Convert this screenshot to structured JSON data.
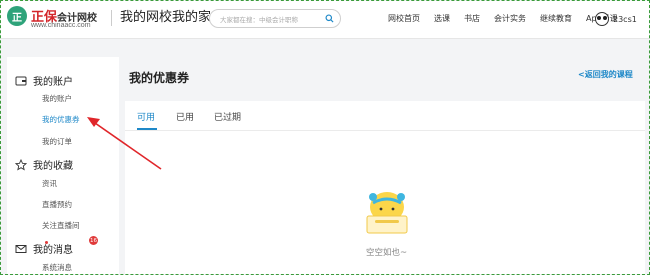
{
  "header": {
    "logo_mark": "正",
    "logo_brand_red": "正保",
    "logo_brand_rest": "会计网校",
    "logo_url": "www.chinaacc.com",
    "site_title": "我的网校我的家",
    "search": {
      "placeholder": "大家都在搜：中级会计职称"
    },
    "nav": [
      "网校首页",
      "选课",
      "书店",
      "会计实务",
      "继续教育",
      "App看课"
    ],
    "username": "23cs1"
  },
  "sidebar": {
    "account": {
      "title": "我的账户",
      "items": [
        "我的账户",
        "我的优惠券",
        "我的订单"
      ]
    },
    "favorites": {
      "title": "我的收藏",
      "items": [
        "资讯",
        "直播预约",
        "关注直播间"
      ]
    },
    "messages": {
      "title": "我的消息",
      "badge": "16",
      "items": [
        "系统消息"
      ]
    }
  },
  "main": {
    "title": "我的优惠券",
    "back_link": "<返回我的课程",
    "tabs": [
      "可用",
      "已用",
      "已过期"
    ],
    "empty_text": "空空如也~"
  },
  "colors": {
    "accent": "#1e88c8",
    "brand_green": "#2ea37a",
    "brand_red": "#d3262a",
    "annotation": "#e0262a"
  }
}
